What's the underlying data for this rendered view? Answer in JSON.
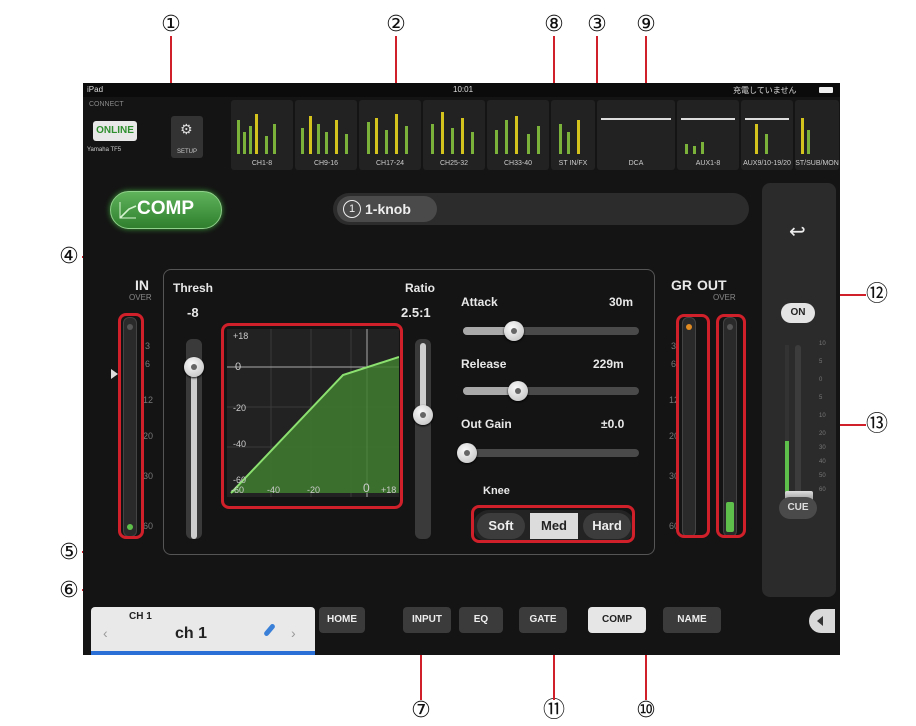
{
  "callouts": [
    "①",
    "②",
    "⑧",
    "③",
    "⑨",
    "④",
    "⑫",
    "⑬",
    "⑤",
    "⑥",
    "⑦",
    "⑪",
    "⑩"
  ],
  "status": {
    "device": "iPad",
    "time": "10:01",
    "battery": "充電していません"
  },
  "connect": {
    "label": "CONNECT",
    "online": "ONLINE",
    "model": "Yamaha TF5",
    "setup": "SETUP"
  },
  "strips": [
    "CH1-8",
    "CH9-16",
    "CH17-24",
    "CH25-32",
    "CH33-40",
    "ST IN/FX",
    "DCA",
    "AUX1-8",
    "AUX9/10-19/20",
    "ST/SUB/MON"
  ],
  "comp_button": "COMP",
  "library": {
    "number": "1",
    "name": "1-knob"
  },
  "in_meter": {
    "title": "IN",
    "over": "OVER",
    "scale": [
      "3",
      "6",
      "12",
      "20",
      "30",
      "60"
    ]
  },
  "thresh": {
    "label": "Thresh",
    "value": "-8"
  },
  "ratio": {
    "label": "Ratio",
    "value": "2.5:1"
  },
  "graph": {
    "y_ticks": [
      "+18",
      "0",
      "-20",
      "-40",
      "-60"
    ],
    "x_ticks": [
      "-60",
      "-40",
      "-20",
      "0",
      "+18"
    ]
  },
  "attack": {
    "label": "Attack",
    "value": "30m",
    "level": 0.29
  },
  "release": {
    "label": "Release",
    "value": "229m",
    "level": 0.31
  },
  "out_gain": {
    "label": "Out Gain",
    "value": "±0.0",
    "level": 0.0
  },
  "knee": {
    "label": "Knee",
    "options": [
      "Soft",
      "Med",
      "Hard"
    ],
    "selected": "Med"
  },
  "gr_out": {
    "gr": "GR",
    "out": "OUT",
    "over": "OVER",
    "scale": [
      "3",
      "6",
      "12",
      "20",
      "30",
      "60"
    ]
  },
  "side": {
    "on": "ON",
    "cue": "CUE",
    "scale": [
      "10",
      "5",
      "0",
      "5",
      "10",
      "20",
      "30",
      "40",
      "50",
      "60"
    ]
  },
  "channel": {
    "number": "CH 1",
    "name": "ch 1"
  },
  "tabs": [
    "HOME",
    "INPUT",
    "EQ",
    "GATE",
    "COMP",
    "NAME"
  ],
  "active_tab": "COMP"
}
